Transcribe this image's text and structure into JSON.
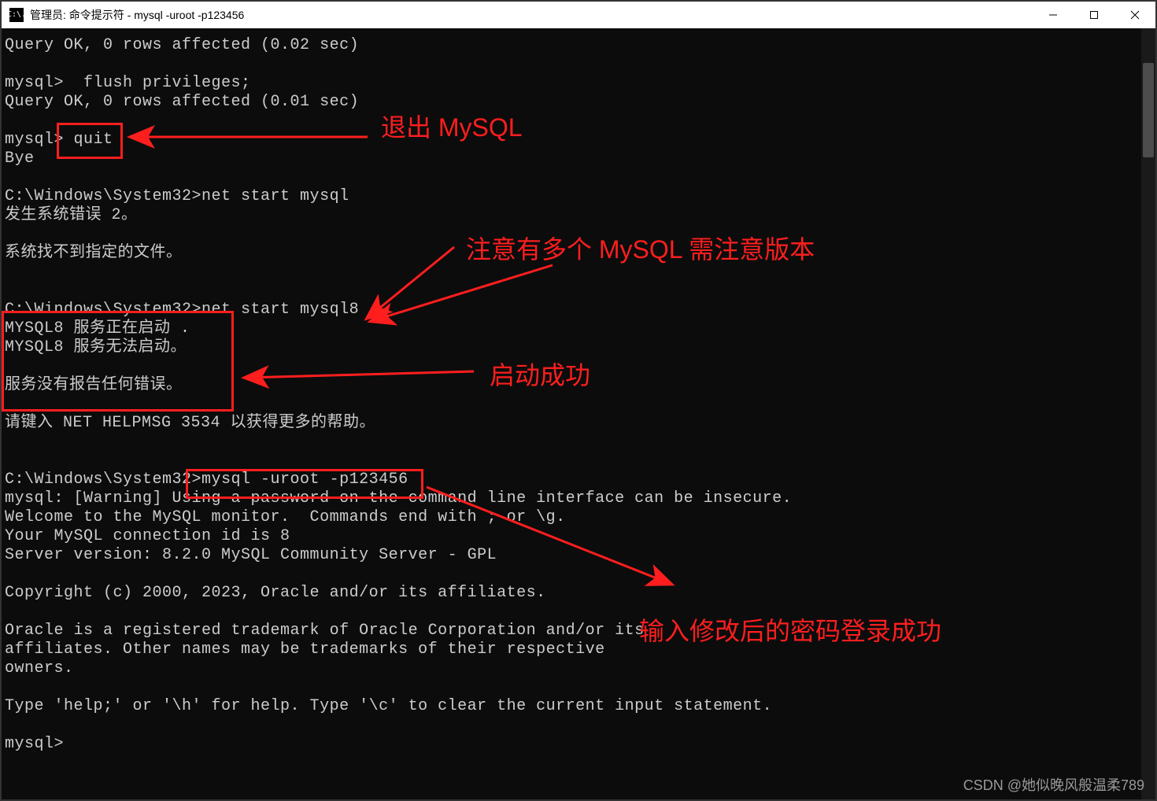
{
  "window": {
    "icon_label": "C:\\.",
    "title": "管理员: 命令提示符 - mysql  -uroot -p123456"
  },
  "terminal": {
    "lines": [
      "Query OK, 0 rows affected (0.02 sec)",
      "",
      "mysql>  flush privileges;",
      "Query OK, 0 rows affected (0.01 sec)",
      "",
      "mysql> quit",
      "Bye",
      "",
      "C:\\Windows\\System32>net start mysql",
      "发生系统错误 2。",
      "",
      "系统找不到指定的文件。",
      "",
      "",
      "C:\\Windows\\System32>net start mysql8",
      "MYSQL8 服务正在启动 .",
      "MYSQL8 服务无法启动。",
      "",
      "服务没有报告任何错误。",
      "",
      "请键入 NET HELPMSG 3534 以获得更多的帮助。",
      "",
      "",
      "C:\\Windows\\System32>mysql -uroot -p123456",
      "mysql: [Warning] Using a password on the command line interface can be insecure.",
      "Welcome to the MySQL monitor.  Commands end with ; or \\g.",
      "Your MySQL connection id is 8",
      "Server version: 8.2.0 MySQL Community Server - GPL",
      "",
      "Copyright (c) 2000, 2023, Oracle and/or its affiliates.",
      "",
      "Oracle is a registered trademark of Oracle Corporation and/or its",
      "affiliates. Other names may be trademarks of their respective",
      "owners.",
      "",
      "Type 'help;' or '\\h' for help. Type '\\c' to clear the current input statement.",
      "",
      "mysql>"
    ]
  },
  "annotations": {
    "a1": "退出  MySQL",
    "a2": "注意有多个 MySQL 需注意版本",
    "a3": "启动成功",
    "a4": "输入修改后的密码登录成功"
  },
  "watermark": "CSDN @她似晚风般温柔789"
}
